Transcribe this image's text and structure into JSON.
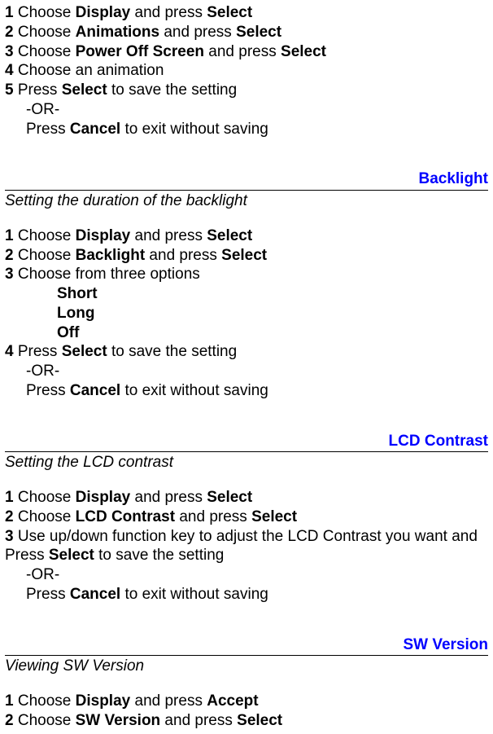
{
  "sect1": {
    "l1": {
      "num": "1",
      "a": " Choose ",
      "b": "Display",
      "c": " and press ",
      "d": "Select"
    },
    "l2": {
      "num": "2",
      "a": " Choose ",
      "b": "Animations",
      "c": " and press ",
      "d": "Select"
    },
    "l3": {
      "num": "3",
      "a": " Choose ",
      "b": "Power Off Screen",
      "c": " and press ",
      "d": "Select"
    },
    "l4": {
      "num": "4",
      "a": " Choose an animation"
    },
    "l5": {
      "num": "5",
      "a": " Press ",
      "b": "Select",
      "c": " to save the setting"
    },
    "or": "-OR-",
    "l6": {
      "a": "Press ",
      "b": "Cancel",
      "c": " to exit without saving"
    }
  },
  "sect2": {
    "title": "Backlight",
    "sub": "Setting the duration of the backlight",
    "l1": {
      "num": "1",
      "a": " Choose ",
      "b": "Display",
      "c": " and press ",
      "d": "Select"
    },
    "l2": {
      "num": "2",
      "a": " Choose ",
      "b": "Backlight",
      "c": " and press ",
      "d": "Select"
    },
    "l3": {
      "num": "3",
      "a": " Choose from three options"
    },
    "opt1": "Short",
    "opt2": "Long",
    "opt3": "Off",
    "l4": {
      "num": "4",
      "a": " Press ",
      "b": "Select",
      "c": " to save the setting"
    },
    "or": "-OR-",
    "l5": {
      "a": "Press ",
      "b": "Cancel",
      "c": " to exit without saving"
    }
  },
  "sect3": {
    "title": "LCD Contrast",
    "sub": "Setting the LCD contrast",
    "l1": {
      "num": "1",
      "a": " Choose ",
      "b": "Display",
      "c": " and press ",
      "d": "Select"
    },
    "l2": {
      "num": "2",
      "a": " Choose ",
      "b": "LCD Contrast",
      "c": " and press ",
      "d": "Select"
    },
    "l3": {
      "num": "3",
      "a": " Use up/down function key to adjust the LCD Contrast you want and Press ",
      "b": "Select",
      "c": " to save the setting"
    },
    "or": "-OR-",
    "l4": {
      "a": "Press ",
      "b": "Cancel",
      "c": " to exit without saving"
    }
  },
  "sect4": {
    "title": "SW Version",
    "sub": "Viewing SW Version",
    "l1": {
      "num": "1",
      "a": " Choose ",
      "b": "Display",
      "c": " and press ",
      "d": "Accept"
    },
    "l2": {
      "num": "2",
      "a": " Choose ",
      "b": "SW Version",
      "c": " and press ",
      "d": "Select"
    }
  }
}
